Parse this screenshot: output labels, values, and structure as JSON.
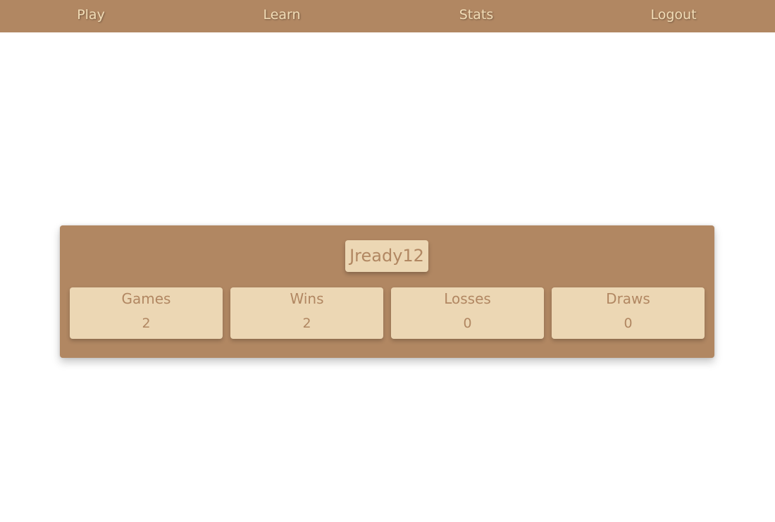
{
  "nav": {
    "play": "Play",
    "learn": "Learn",
    "stats": "Stats",
    "logout": "Logout"
  },
  "profile": {
    "username": "Jready12"
  },
  "stats": [
    {
      "label": "Games",
      "value": "2"
    },
    {
      "label": "Wins",
      "value": "2"
    },
    {
      "label": "Losses",
      "value": "0"
    },
    {
      "label": "Draws",
      "value": "0"
    }
  ],
  "colors": {
    "accent": "#b18762",
    "card": "#ecd7b4",
    "nav_text": "#f1dcb6",
    "background": "#ffffff"
  }
}
